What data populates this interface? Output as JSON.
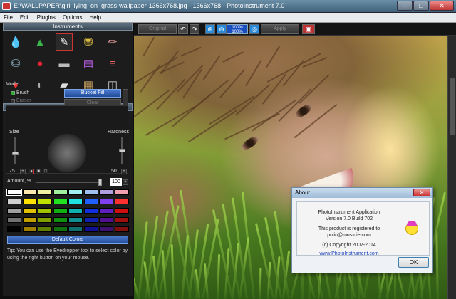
{
  "window": {
    "title": "E:\\WALLPAPER\\girl_lying_on_grass-wallpaper-1366x768.jpg - 1366x768 - PhotoInstrument 7.0",
    "minimize": "–",
    "maximize": "□",
    "close": "✕"
  },
  "menu": [
    "File",
    "Edit",
    "Plugins",
    "Options",
    "Help"
  ],
  "instruments": {
    "header": "Instruments",
    "tools": [
      {
        "icon": "water-drop-icon",
        "glyph": "💧",
        "color": "#3aa8e6"
      },
      {
        "icon": "green-drop-icon",
        "glyph": "▲",
        "color": "#39b54a"
      },
      {
        "icon": "brush-tool-icon",
        "glyph": "✎",
        "color": "#ffffff",
        "selected": true
      },
      {
        "icon": "stamp-icon",
        "glyph": "⛃",
        "color": "#e0c040"
      },
      {
        "icon": "pencil-icon",
        "glyph": "✏",
        "color": "#f0a0a0"
      },
      {
        "icon": "bucket-icon",
        "glyph": "⛁",
        "color": "#8ab"
      },
      {
        "icon": "color-circle-icon",
        "glyph": "●",
        "color": "#e23"
      },
      {
        "icon": "gradient-icon",
        "glyph": "▬",
        "color": "#bbb"
      },
      {
        "icon": "color-bars-icon",
        "glyph": "▤",
        "color": "#c6f"
      },
      {
        "icon": "pens-icon",
        "glyph": "≡",
        "color": "#e66"
      },
      {
        "icon": "lipstick-icon",
        "glyph": "♦",
        "color": "#e33"
      },
      {
        "icon": "droplet-icon",
        "glyph": "◐",
        "color": "#aaa"
      },
      {
        "icon": "eraser-icon",
        "glyph": "▰",
        "color": "#ddd"
      },
      {
        "icon": "tablet-icon",
        "glyph": "▦",
        "color": "#c8a060"
      },
      {
        "icon": "layers-icon",
        "glyph": "◫",
        "color": "#ccc"
      }
    ]
  },
  "brush": {
    "header": "Brush",
    "mode_label": "Mode",
    "brush_label": "Brush",
    "eraser_label": "Eraser",
    "bucket_fill": "Bucket Fill",
    "clear": "Clear",
    "size_label": "Size",
    "hardness_label": "Hardness",
    "size_value": "75",
    "hardness_value": "50",
    "amount_label": "Amount, %",
    "amount_value": "100",
    "amount_fraction": 0.98,
    "size_fraction": 0.35,
    "hardness_fraction": 0.5
  },
  "palette": {
    "colors": [
      [
        "#ffffff",
        "#ffe8b0",
        "#f0f0a0",
        "#a0f0a0",
        "#a0f0f0",
        "#a0c0f0",
        "#b0a0e0",
        "#f0a0b0"
      ],
      [
        "#d0d0d0",
        "#ffe000",
        "#c0e000",
        "#20e020",
        "#20e0e0",
        "#2060ff",
        "#8040f0",
        "#ff3030"
      ],
      [
        "#a0a0a0",
        "#e0c000",
        "#a0c000",
        "#10b010",
        "#10b0b0",
        "#1030e0",
        "#6020c0",
        "#d01010"
      ],
      [
        "#707070",
        "#c0a000",
        "#80a000",
        "#109010",
        "#109090",
        "#1020b0",
        "#501090",
        "#a01010"
      ],
      [
        "#000000",
        "#a08000",
        "#608000",
        "#107010",
        "#107070",
        "#101090",
        "#401070",
        "#801010"
      ]
    ],
    "default_colors": "Default Colors"
  },
  "tip": "Tip: You can use the Eyedropper tool to select color by using the right button on your mouse.",
  "toolbar": {
    "original": "Original",
    "undo": "↶",
    "redo": "↷",
    "zoom_top": "100%",
    "zoom_bottom": "100%",
    "apply": "Apply"
  },
  "about": {
    "title": "About",
    "close": "✕",
    "line1": "PhotoInstrument Application",
    "line2": "Version 7.0 Build 702",
    "line3": "This product is registered to",
    "line4": "pulin@mustdie.com",
    "line5": "(c) Copyright 2007-2014",
    "link": "www.PhotoInstrument.com",
    "ok": "OK"
  }
}
